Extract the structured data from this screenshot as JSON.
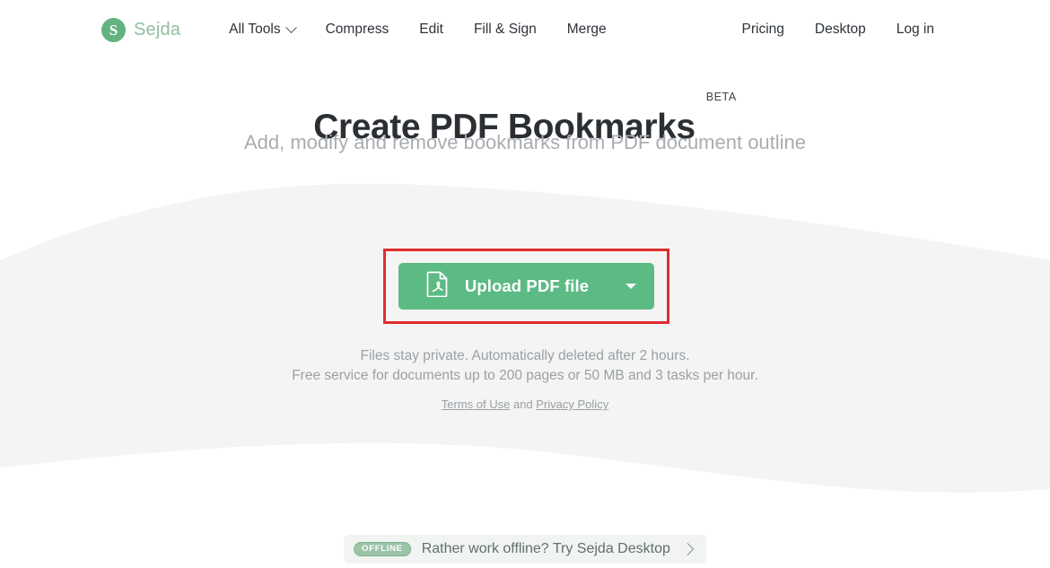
{
  "brand": {
    "mark_letter": "S",
    "name": "Sejda"
  },
  "nav": {
    "left_items": [
      {
        "label": "All Tools",
        "has_caret": true
      },
      {
        "label": "Compress",
        "has_caret": false
      },
      {
        "label": "Edit",
        "has_caret": false
      },
      {
        "label": "Fill & Sign",
        "has_caret": false
      },
      {
        "label": "Merge",
        "has_caret": false
      }
    ],
    "right_items": [
      {
        "label": "Pricing"
      },
      {
        "label": "Desktop"
      },
      {
        "label": "Log in"
      }
    ]
  },
  "hero": {
    "title": "Create PDF Bookmarks",
    "badge": "BETA",
    "subtitle": "Add, modify and remove bookmarks from PDF document outline"
  },
  "upload": {
    "label": "Upload PDF file",
    "icon": "pdf-file-icon",
    "dropdown_icon": "caret-down-icon",
    "button_color": "#5cba84",
    "highlight_color": "#e02d2d"
  },
  "notes": {
    "line1": "Files stay private. Automatically deleted after 2 hours.",
    "line2": "Free service for documents up to 200 pages or 50 MB and 3 tasks per hour.",
    "terms_label": "Terms of Use",
    "conjunction": " and ",
    "privacy_label": "Privacy Policy"
  },
  "offline_banner": {
    "badge": "OFFLINE",
    "text": "Rather work offline? Try Sejda Desktop",
    "arrow_icon": "chevron-right-icon"
  },
  "colors": {
    "band_gray": "#f4f4f4",
    "brand_green": "#62b37f"
  }
}
